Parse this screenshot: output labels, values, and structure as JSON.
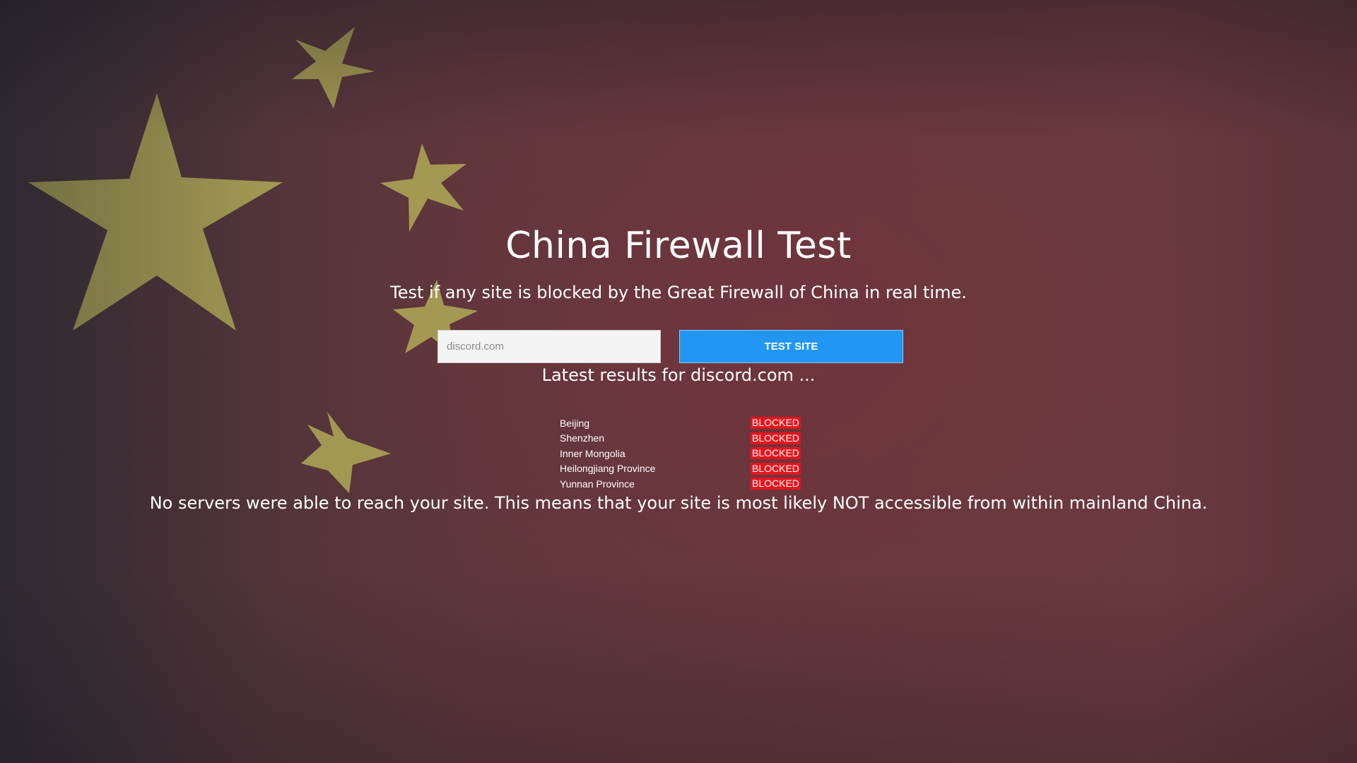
{
  "page": {
    "title": "China Firewall Test",
    "subtitle": "Test if any site is blocked by the Great Firewall of China in real time."
  },
  "search": {
    "value": "",
    "placeholder": "discord.com",
    "button_label": "TEST SITE"
  },
  "results": {
    "heading": "Latest results for discord.com ...",
    "rows": [
      {
        "location": "Beijing",
        "status": "BLOCKED"
      },
      {
        "location": "Shenzhen",
        "status": "BLOCKED"
      },
      {
        "location": "Inner Mongolia",
        "status": "BLOCKED"
      },
      {
        "location": "Heilongjiang Province",
        "status": "BLOCKED"
      },
      {
        "location": "Yunnan Province",
        "status": "BLOCKED"
      }
    ],
    "summary": "No servers were able to reach your site. This means that your site is most likely NOT accessible from within mainland China."
  },
  "colors": {
    "button": "#2196f3",
    "blocked_badge": "#e8141c",
    "star": "#b9b45a"
  },
  "background": {
    "image": "china-flag-background",
    "icon": "star-icon"
  }
}
